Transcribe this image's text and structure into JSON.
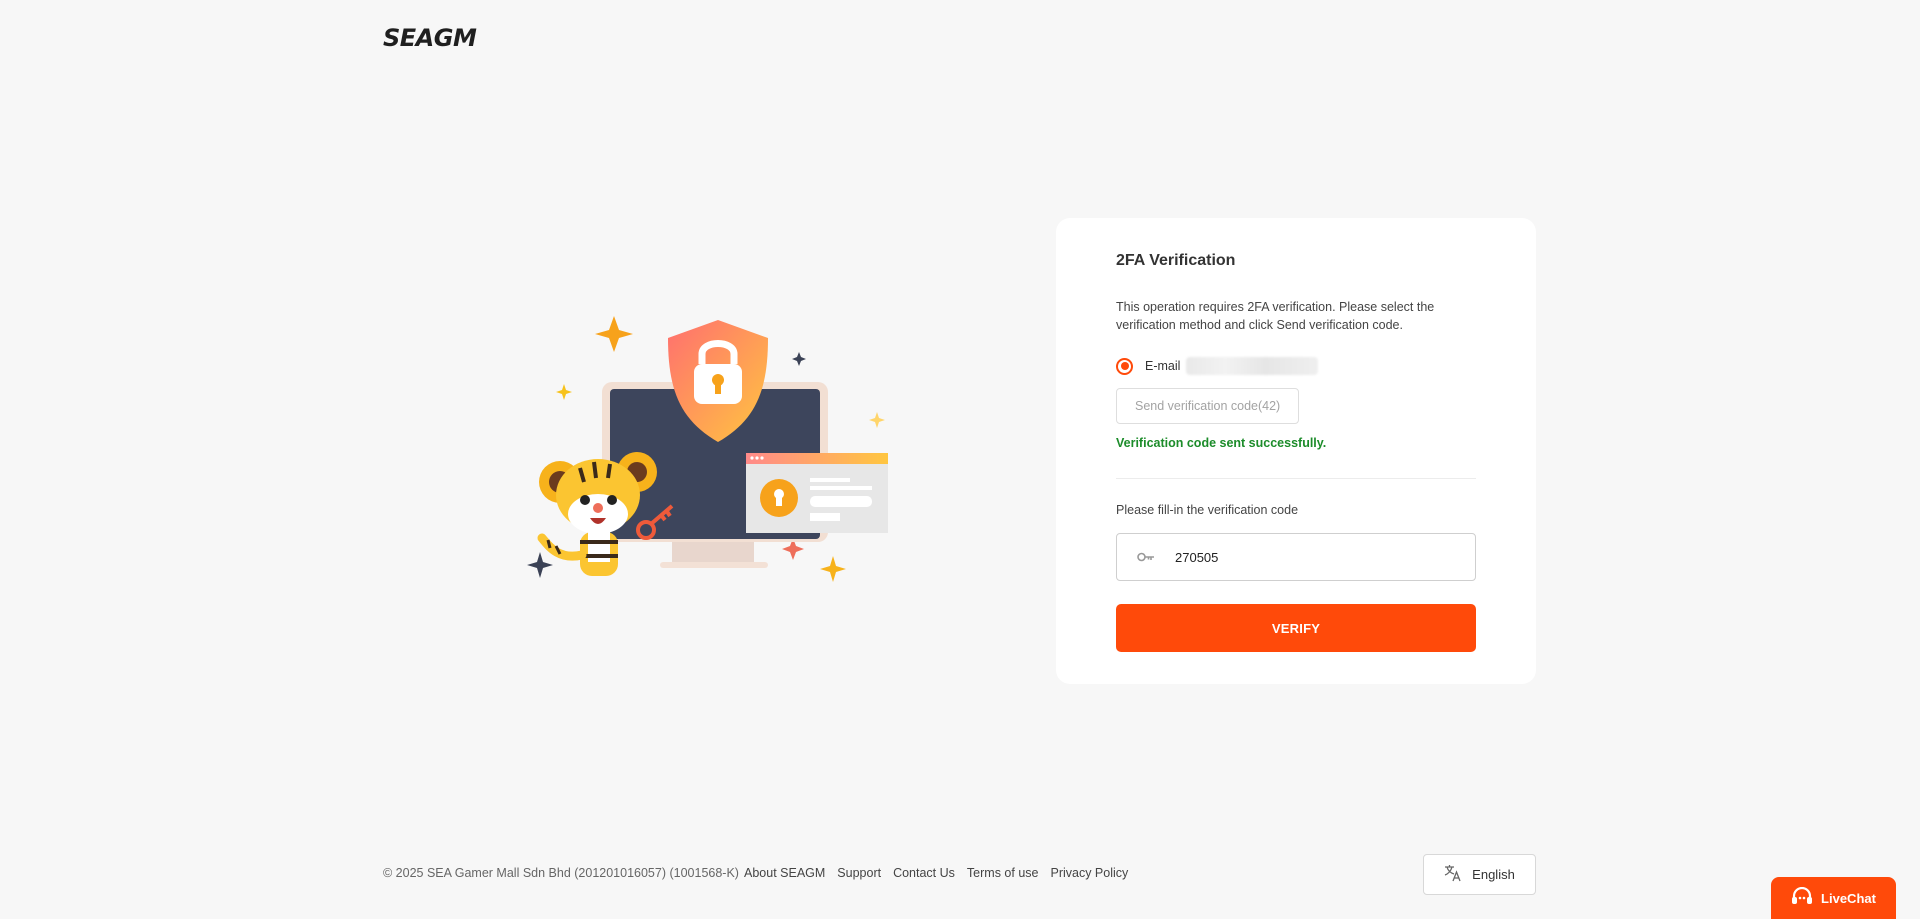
{
  "header": {
    "logo_text": "SEAGM"
  },
  "card": {
    "title": "2FA Verification",
    "description": "This operation requires 2FA verification. Please select the verification method and click Send verification code.",
    "method": {
      "label": "E-mail",
      "selected": true
    },
    "send_button_label": "Send verification code(42)",
    "success_message": "Verification code sent successfully.",
    "code_label": "Please fill-in the verification code",
    "code_value": "270505",
    "verify_button_label": "VERIFY"
  },
  "footer": {
    "copyright": "© 2025 SEA Gamer Mall Sdn Bhd (201201016057) (1001568-K)",
    "links": [
      "About SEAGM",
      "Support",
      "Contact Us",
      "Terms of use",
      "Privacy Policy"
    ],
    "language": "English"
  },
  "livechat": {
    "label": "LiveChat"
  },
  "colors": {
    "accent": "#ff4a0a",
    "success": "#1c8c2a",
    "background": "#f7f7f7"
  }
}
